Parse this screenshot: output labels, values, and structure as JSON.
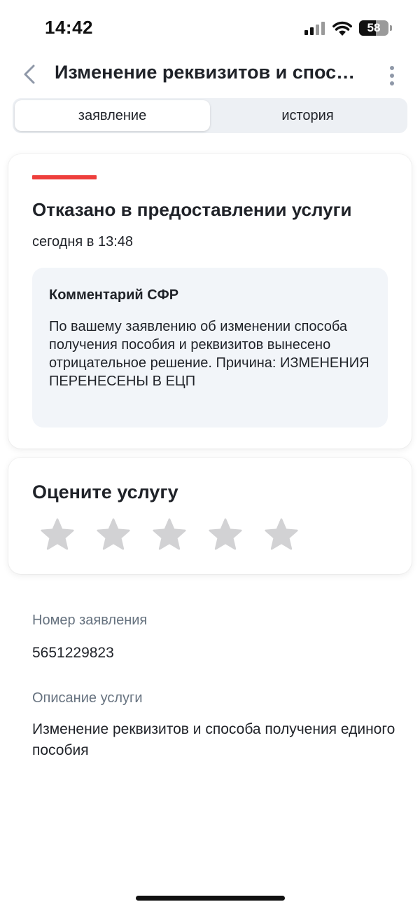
{
  "status_bar": {
    "time": "14:42",
    "battery_level": "58",
    "icons": [
      "signal-icon",
      "wifi-icon",
      "battery-icon"
    ]
  },
  "header": {
    "back_icon": "chevron-left-icon",
    "title": "Изменение реквизитов и способа получения единого пособия",
    "more_icon": "more-vertical-icon"
  },
  "tabs": [
    {
      "label": "заявление",
      "active": true
    },
    {
      "label": "история",
      "active": false
    }
  ],
  "status": {
    "accent_color": "#ee3f3c",
    "title": "Отказано в предоставлении услуги",
    "date": "сегодня в 13:48",
    "comment_title": "Комментарий СФР",
    "comment_text": "По вашему заявлению об изменении способа получения пособия и реквизитов вынесено отрицательное решение. Причина: ИЗМЕНЕНИЯ ПЕРЕНЕСЕНЫ В ЕЦП"
  },
  "rating": {
    "title": "Оцените услугу",
    "max_stars": 5,
    "selected": 0,
    "star_color": "#d2d2d4"
  },
  "details": {
    "application_number_label": "Номер заявления",
    "application_number": "5651229823",
    "service_description_label": "Описание услуги",
    "service_description": "Изменение реквизитов и способа получения единого пособия"
  }
}
